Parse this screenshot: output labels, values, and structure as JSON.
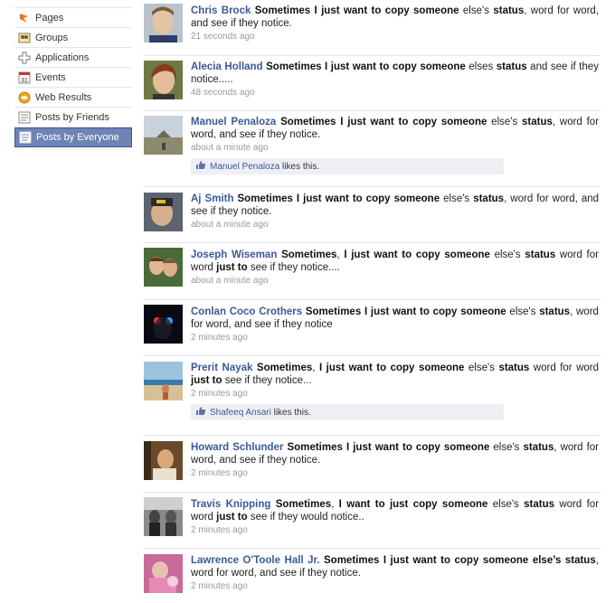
{
  "sidebar": {
    "items": [
      {
        "label": "Pages",
        "icon": "pages-icon"
      },
      {
        "label": "Groups",
        "icon": "groups-icon"
      },
      {
        "label": "Applications",
        "icon": "applications-icon"
      },
      {
        "label": "Events",
        "icon": "events-icon",
        "icon_text": "31"
      },
      {
        "label": "Web Results",
        "icon": "web-results-icon"
      },
      {
        "label": "Posts by Friends",
        "icon": "posts-friends-icon"
      },
      {
        "label": "Posts by Everyone",
        "icon": "posts-everyone-icon",
        "selected": true
      }
    ]
  },
  "feed": {
    "stories": [
      {
        "name": "Chris Brock",
        "time": "21 seconds ago"
      },
      {
        "name": "Alecia Holland",
        "time": "48 seconds ago"
      },
      {
        "name": "Manuel Penaloza",
        "time": "about a minute ago",
        "liker": "Manuel Penaloza",
        "likes_text": " likes this."
      },
      {
        "name": "Aj Smith",
        "time": "about a minute ago"
      },
      {
        "name": "Joseph Wiseman",
        "time": "about a minute ago"
      },
      {
        "name": "Conlan Coco Crothers",
        "time": "2 minutes ago"
      },
      {
        "name": "Prerit Nayak",
        "time": "2 minutes ago",
        "liker": "Shafeeq Ansari",
        "likes_text": " likes this."
      },
      {
        "name": "Howard Schlunder",
        "time": "2 minutes ago"
      },
      {
        "name": "Travis Knipping",
        "time": "2 minutes ago"
      },
      {
        "name": "Lawrence O'Toole Hall Jr.",
        "time": "2 minutes ago"
      }
    ]
  },
  "colors": {
    "link": "#3b5998",
    "selected_bg": "#6d84b4",
    "like_bar": "#edeff4"
  }
}
